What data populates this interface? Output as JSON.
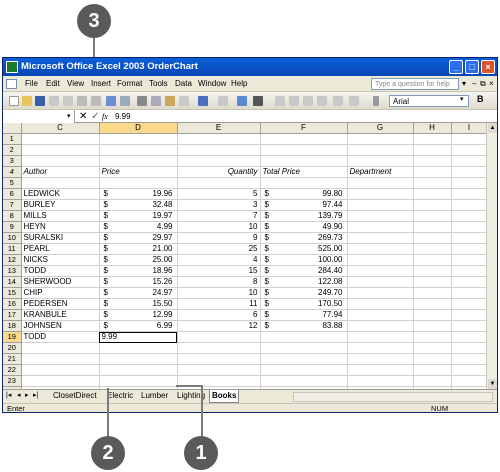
{
  "window": {
    "title": "Microsoft Office Excel 2003 OrderChart"
  },
  "menu": {
    "items": [
      "File",
      "Edit",
      "View",
      "Insert",
      "Format",
      "Tools",
      "Data",
      "Window",
      "Help"
    ],
    "help_placeholder": "Type a question for help"
  },
  "toolbar": {
    "font": "Arial",
    "bold_label": "B"
  },
  "formula_bar": {
    "value": "9.99",
    "fx_label": "fx"
  },
  "columns": [
    "C",
    "D",
    "E",
    "F",
    "G",
    "H",
    "I"
  ],
  "rows": [
    {
      "n": "1",
      "author": "",
      "p_sym": "",
      "price": "",
      "qty": "",
      "t_sym": "",
      "total": "",
      "dept": ""
    },
    {
      "n": "2",
      "author": "",
      "p_sym": "",
      "price": "",
      "qty": "",
      "t_sym": "",
      "total": "",
      "dept": ""
    },
    {
      "n": "3",
      "author": "",
      "p_sym": "",
      "price": "",
      "qty": "",
      "t_sym": "",
      "total": "",
      "dept": ""
    },
    {
      "n": "4",
      "author": "Author",
      "p_sym": "Price",
      "price": "",
      "qty": "Quantity",
      "t_sym": "Total Price",
      "total": "",
      "dept": "Department"
    },
    {
      "n": "5",
      "author": "",
      "p_sym": "",
      "price": "",
      "qty": "",
      "t_sym": "",
      "total": "",
      "dept": ""
    },
    {
      "n": "6",
      "author": "LEDWICK",
      "p_sym": "$",
      "price": "19.96",
      "qty": "5",
      "t_sym": "$",
      "total": "99.80",
      "dept": ""
    },
    {
      "n": "7",
      "author": "BURLEY",
      "p_sym": "$",
      "price": "32.48",
      "qty": "3",
      "t_sym": "$",
      "total": "97.44",
      "dept": ""
    },
    {
      "n": "8",
      "author": "MILLS",
      "p_sym": "$",
      "price": "19.97",
      "qty": "7",
      "t_sym": "$",
      "total": "139.79",
      "dept": ""
    },
    {
      "n": "9",
      "author": "HEYN",
      "p_sym": "$",
      "price": "4.99",
      "qty": "10",
      "t_sym": "$",
      "total": "49.90",
      "dept": ""
    },
    {
      "n": "10",
      "author": "SURALSKI",
      "p_sym": "$",
      "price": "29.97",
      "qty": "9",
      "t_sym": "$",
      "total": "269.73",
      "dept": ""
    },
    {
      "n": "11",
      "author": "PEARL",
      "p_sym": "$",
      "price": "21.00",
      "qty": "25",
      "t_sym": "$",
      "total": "525.00",
      "dept": ""
    },
    {
      "n": "12",
      "author": "NICKS",
      "p_sym": "$",
      "price": "25.00",
      "qty": "4",
      "t_sym": "$",
      "total": "100.00",
      "dept": ""
    },
    {
      "n": "13",
      "author": "TODD",
      "p_sym": "$",
      "price": "18.96",
      "qty": "15",
      "t_sym": "$",
      "total": "284.40",
      "dept": ""
    },
    {
      "n": "14",
      "author": "SHERWOOD",
      "p_sym": "$",
      "price": "15.26",
      "qty": "8",
      "t_sym": "$",
      "total": "122.08",
      "dept": ""
    },
    {
      "n": "15",
      "author": "CHIP",
      "p_sym": "$",
      "price": "24.97",
      "qty": "10",
      "t_sym": "$",
      "total": "249.70",
      "dept": ""
    },
    {
      "n": "16",
      "author": "PEDERSEN",
      "p_sym": "$",
      "price": "15.50",
      "qty": "11",
      "t_sym": "$",
      "total": "170.50",
      "dept": ""
    },
    {
      "n": "17",
      "author": "KRANBULE",
      "p_sym": "$",
      "price": "12.99",
      "qty": "6",
      "t_sym": "$",
      "total": "77.94",
      "dept": ""
    },
    {
      "n": "18",
      "author": "JOHNSEN",
      "p_sym": "$",
      "price": "6.99",
      "qty": "12",
      "t_sym": "$",
      "total": "83.88",
      "dept": ""
    },
    {
      "n": "19",
      "author": "TODD",
      "p_sym": "9.99",
      "price": "",
      "qty": "",
      "t_sym": "",
      "total": "",
      "dept": ""
    },
    {
      "n": "20",
      "author": "",
      "p_sym": "",
      "price": "",
      "qty": "",
      "t_sym": "",
      "total": "",
      "dept": ""
    },
    {
      "n": "21",
      "author": "",
      "p_sym": "",
      "price": "",
      "qty": "",
      "t_sym": "",
      "total": "",
      "dept": ""
    },
    {
      "n": "22",
      "author": "",
      "p_sym": "",
      "price": "",
      "qty": "",
      "t_sym": "",
      "total": "",
      "dept": ""
    },
    {
      "n": "23",
      "author": "",
      "p_sym": "",
      "price": "",
      "qty": "",
      "t_sym": "",
      "total": "",
      "dept": ""
    },
    {
      "n": "24",
      "author": "",
      "p_sym": "",
      "price": "",
      "qty": "",
      "t_sym": "",
      "total": "",
      "dept": ""
    },
    {
      "n": "25",
      "author": "",
      "p_sym": "",
      "price": "",
      "qty": "",
      "t_sym": "",
      "total": "",
      "dept": ""
    }
  ],
  "sheet_tabs": [
    "ClosetDirect",
    "Electric",
    "Lumber",
    "Lighting",
    "Books"
  ],
  "active_tab": "Books",
  "status": {
    "mode": "Enter",
    "num": "NUM"
  },
  "callouts": [
    "3",
    "2",
    "1"
  ]
}
